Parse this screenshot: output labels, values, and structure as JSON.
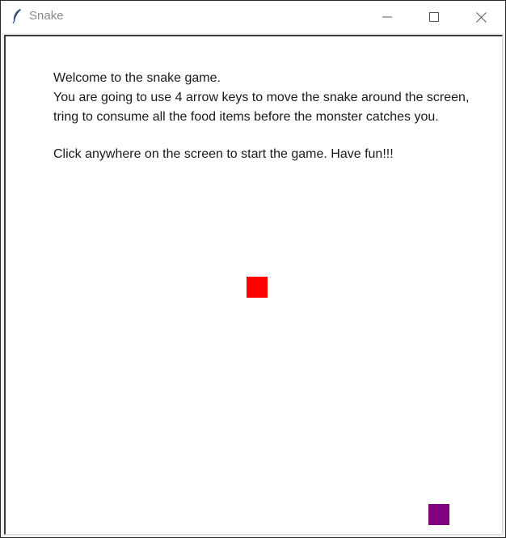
{
  "window": {
    "title": "Snake",
    "app_icon": "feather-icon",
    "controls": {
      "minimize_icon": "minimize-icon",
      "maximize_icon": "maximize-icon",
      "close_icon": "close-icon"
    }
  },
  "game": {
    "instructions": [
      "Welcome to the snake game.",
      "You are going to use 4 arrow keys to move the snake around the screen,",
      "tring to consume all the food items before the monster catches you.",
      "",
      "Click anywhere on the screen to start the game. Have fun!!!"
    ],
    "colors": {
      "background": "#ffffff",
      "food": "#ff0000",
      "monster": "#800080"
    },
    "items": {
      "food": "red-square",
      "monster": "purple-square"
    }
  }
}
